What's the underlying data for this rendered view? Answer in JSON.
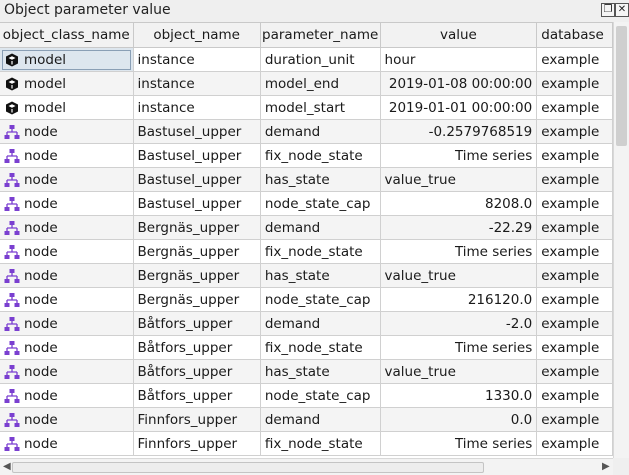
{
  "window": {
    "title": "Object parameter value",
    "float_icon": "float-icon",
    "close_icon": "close-icon"
  },
  "columns": [
    "object_class_name",
    "object_name",
    "parameter_name",
    "value",
    "database"
  ],
  "rows": [
    {
      "cls": "model",
      "icon": "model-cube-icon",
      "obj": "instance",
      "param": "duration_unit",
      "value": "hour",
      "align": "left",
      "db": "example"
    },
    {
      "cls": "model",
      "icon": "model-cube-icon",
      "obj": "instance",
      "param": "model_end",
      "value": "2019-01-08 00:00:00",
      "align": "right",
      "db": "example"
    },
    {
      "cls": "model",
      "icon": "model-cube-icon",
      "obj": "instance",
      "param": "model_start",
      "value": "2019-01-01 00:00:00",
      "align": "right",
      "db": "example"
    },
    {
      "cls": "node",
      "icon": "node-network-icon",
      "obj": "Bastusel_upper",
      "param": "demand",
      "value": "-0.2579768519",
      "align": "right",
      "db": "example"
    },
    {
      "cls": "node",
      "icon": "node-network-icon",
      "obj": "Bastusel_upper",
      "param": "fix_node_state",
      "value": "Time series",
      "align": "right",
      "db": "example"
    },
    {
      "cls": "node",
      "icon": "node-network-icon",
      "obj": "Bastusel_upper",
      "param": "has_state",
      "value": "value_true",
      "align": "left",
      "db": "example"
    },
    {
      "cls": "node",
      "icon": "node-network-icon",
      "obj": "Bastusel_upper",
      "param": "node_state_cap",
      "value": "8208.0",
      "align": "right",
      "db": "example"
    },
    {
      "cls": "node",
      "icon": "node-network-icon",
      "obj": "Bergnäs_upper",
      "param": "demand",
      "value": "-22.29",
      "align": "right",
      "db": "example"
    },
    {
      "cls": "node",
      "icon": "node-network-icon",
      "obj": "Bergnäs_upper",
      "param": "fix_node_state",
      "value": "Time series",
      "align": "right",
      "db": "example"
    },
    {
      "cls": "node",
      "icon": "node-network-icon",
      "obj": "Bergnäs_upper",
      "param": "has_state",
      "value": "value_true",
      "align": "left",
      "db": "example"
    },
    {
      "cls": "node",
      "icon": "node-network-icon",
      "obj": "Bergnäs_upper",
      "param": "node_state_cap",
      "value": "216120.0",
      "align": "right",
      "db": "example"
    },
    {
      "cls": "node",
      "icon": "node-network-icon",
      "obj": "Båtfors_upper",
      "param": "demand",
      "value": "-2.0",
      "align": "right",
      "db": "example"
    },
    {
      "cls": "node",
      "icon": "node-network-icon",
      "obj": "Båtfors_upper",
      "param": "fix_node_state",
      "value": "Time series",
      "align": "right",
      "db": "example"
    },
    {
      "cls": "node",
      "icon": "node-network-icon",
      "obj": "Båtfors_upper",
      "param": "has_state",
      "value": "value_true",
      "align": "left",
      "db": "example"
    },
    {
      "cls": "node",
      "icon": "node-network-icon",
      "obj": "Båtfors_upper",
      "param": "node_state_cap",
      "value": "1330.0",
      "align": "right",
      "db": "example"
    },
    {
      "cls": "node",
      "icon": "node-network-icon",
      "obj": "Finnfors_upper",
      "param": "demand",
      "value": "0.0",
      "align": "right",
      "db": "example"
    },
    {
      "cls": "node",
      "icon": "node-network-icon",
      "obj": "Finnfors_upper",
      "param": "fix_node_state",
      "value": "Time series",
      "align": "right",
      "db": "example"
    }
  ],
  "colors": {
    "node_icon": "#7a3fd0",
    "model_icon": "#111111",
    "selection": "#dde6ee"
  }
}
